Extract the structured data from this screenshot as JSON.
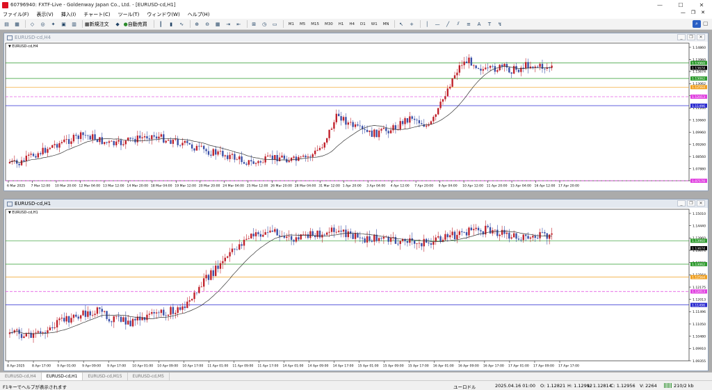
{
  "window": {
    "title": "60796940: FXTF-Live - Goldenway Japan Co., Ltd. - [EURUSD-cd,H1]"
  },
  "menu": [
    "ファイル(F)",
    "表示(V)",
    "挿入(I)",
    "チャート(C)",
    "ツール(T)",
    "ウィンドウ(W)",
    "ヘルプ(H)"
  ],
  "toolbar": {
    "new_order": "新規注文",
    "auto_trade": "自動売買",
    "periods": [
      "M1",
      "M5",
      "M15",
      "M30",
      "H1",
      "H4",
      "D1",
      "W1",
      "MN"
    ]
  },
  "charts": [
    {
      "title": "EURUSD-cd,H4",
      "label": "EURUSD-cd,H4",
      "yticks": [
        "1.14860",
        "1.13960",
        "1.13674",
        "1.13062",
        "1.12160",
        "1.11260",
        "1.10660",
        "1.09960",
        "1.09260",
        "1.08560",
        "1.07880",
        "1.07170"
      ],
      "ylim": [
        1.0717,
        1.1486
      ],
      "price_tags": [
        {
          "text": "1.13960",
          "value": 1.1396,
          "color": "#2e9b2e"
        },
        {
          "text": "1.13674",
          "value": 1.13674,
          "color": "#000000"
        },
        {
          "text": "1.13062",
          "value": 1.13062,
          "color": "#2e9b2e"
        },
        {
          "text": "1.12564",
          "value": 1.12564,
          "color": "#f0a020"
        },
        {
          "text": "1.12013",
          "value": 1.12013,
          "color": "#e040e0"
        },
        {
          "text": "1.11496",
          "value": 1.11496,
          "color": "#2b2bd0"
        },
        {
          "text": "1.07170",
          "value": 1.0717,
          "color": "#e040e0"
        }
      ],
      "xticks": [
        "6 Mar 2025",
        "7 Mar 12:00",
        "10 Mar 20:00",
        "12 Mar 04:00",
        "13 Mar 12:00",
        "14 Mar 20:00",
        "18 Mar 04:00",
        "19 Mar 12:00",
        "20 Mar 20:00",
        "24 Mar 04:00",
        "25 Mar 12:00",
        "26 Mar 20:00",
        "28 Mar 04:00",
        "31 Mar 12:00",
        "1 Apr 20:00",
        "3 Apr 04:00",
        "4 Apr 12:00",
        "7 Apr 20:00",
        "9 Apr 04:00",
        "10 Apr 12:00",
        "11 Apr 20:00",
        "15 Apr 04:00",
        "16 Apr 12:00",
        "17 Apr 20:00"
      ]
    },
    {
      "title": "EURUSD-cd,H1",
      "label": "EURUSD-cd,H1",
      "yticks": [
        "1.15010",
        "1.14440",
        "1.13960",
        "1.13674",
        "1.13062",
        "1.12564",
        "1.12175",
        "1.12013",
        "1.11496",
        "1.11050",
        "1.10480",
        "1.09910",
        "1.09355"
      ],
      "ylim": [
        1.0935,
        1.1501
      ],
      "price_tags": [
        {
          "text": "1.13960",
          "value": 1.1396,
          "color": "#2e9b2e"
        },
        {
          "text": "1.13674",
          "value": 1.13674,
          "color": "#000000"
        },
        {
          "text": "1.13062",
          "value": 1.13062,
          "color": "#2e9b2e"
        },
        {
          "text": "1.12564",
          "value": 1.12564,
          "color": "#f0a020"
        },
        {
          "text": "1.12013",
          "value": 1.12013,
          "color": "#e040e0"
        },
        {
          "text": "1.11496",
          "value": 1.11496,
          "color": "#2b2bd0"
        }
      ],
      "xticks": [
        "8 Apr 2025",
        "8 Apr 17:00",
        "9 Apr 01:00",
        "9 Apr 09:00",
        "9 Apr 17:00",
        "10 Apr 01:00",
        "10 Apr 09:00",
        "10 Apr 17:00",
        "11 Apr 01:00",
        "11 Apr 09:00",
        "11 Apr 17:00",
        "14 Apr 01:00",
        "14 Apr 09:00",
        "14 Apr 17:00",
        "15 Apr 01:00",
        "15 Apr 09:00",
        "15 Apr 17:00",
        "16 Apr 01:00",
        "16 Apr 09:00",
        "16 Apr 17:00",
        "17 Apr 01:00",
        "17 Apr 09:00",
        "17 Apr 17:00"
      ]
    }
  ],
  "tabs": [
    "EURUSD-cd,H4",
    "EURUSD-cd,H1",
    "EURUSD-cd,M15",
    "EURUSD-cd,M5"
  ],
  "active_tab": 1,
  "status": {
    "help": "F1キーでヘルプが表示されます",
    "profile": "ユーロドル",
    "datetime": "2025.04.16 01:00",
    "open": "O: 1.12821",
    "high": "H: 1.12992",
    "low": "L: 1.12814",
    "close": "C: 1.12956",
    "volume": "V: 2264",
    "traffic": "210/2 kb"
  },
  "colors": {
    "bull": "#c0202a",
    "bear": "#3a50a8",
    "ma": "#333333"
  }
}
